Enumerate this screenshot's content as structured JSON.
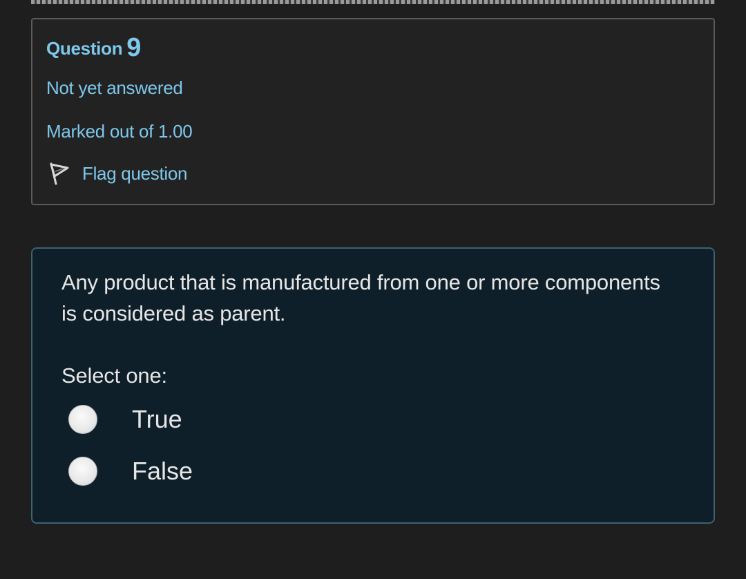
{
  "question": {
    "label": "Question",
    "number": "9",
    "state": "Not yet answered",
    "grade": "Marked out of 1.00",
    "flag_label": "Flag question",
    "flag_icon": "flag-outline-icon"
  },
  "content": {
    "text": "Any product that is manufactured from one or more components is considered as parent.",
    "prompt": "Select one:",
    "options": [
      {
        "label": "True",
        "selected": false
      },
      {
        "label": "False",
        "selected": false
      }
    ]
  },
  "colors": {
    "background": "#1e1e1e",
    "accent_text": "#7ec8ec",
    "content_bg": "#0f1f29",
    "content_border": "#3d6272",
    "body_text": "#e6e6e6"
  }
}
